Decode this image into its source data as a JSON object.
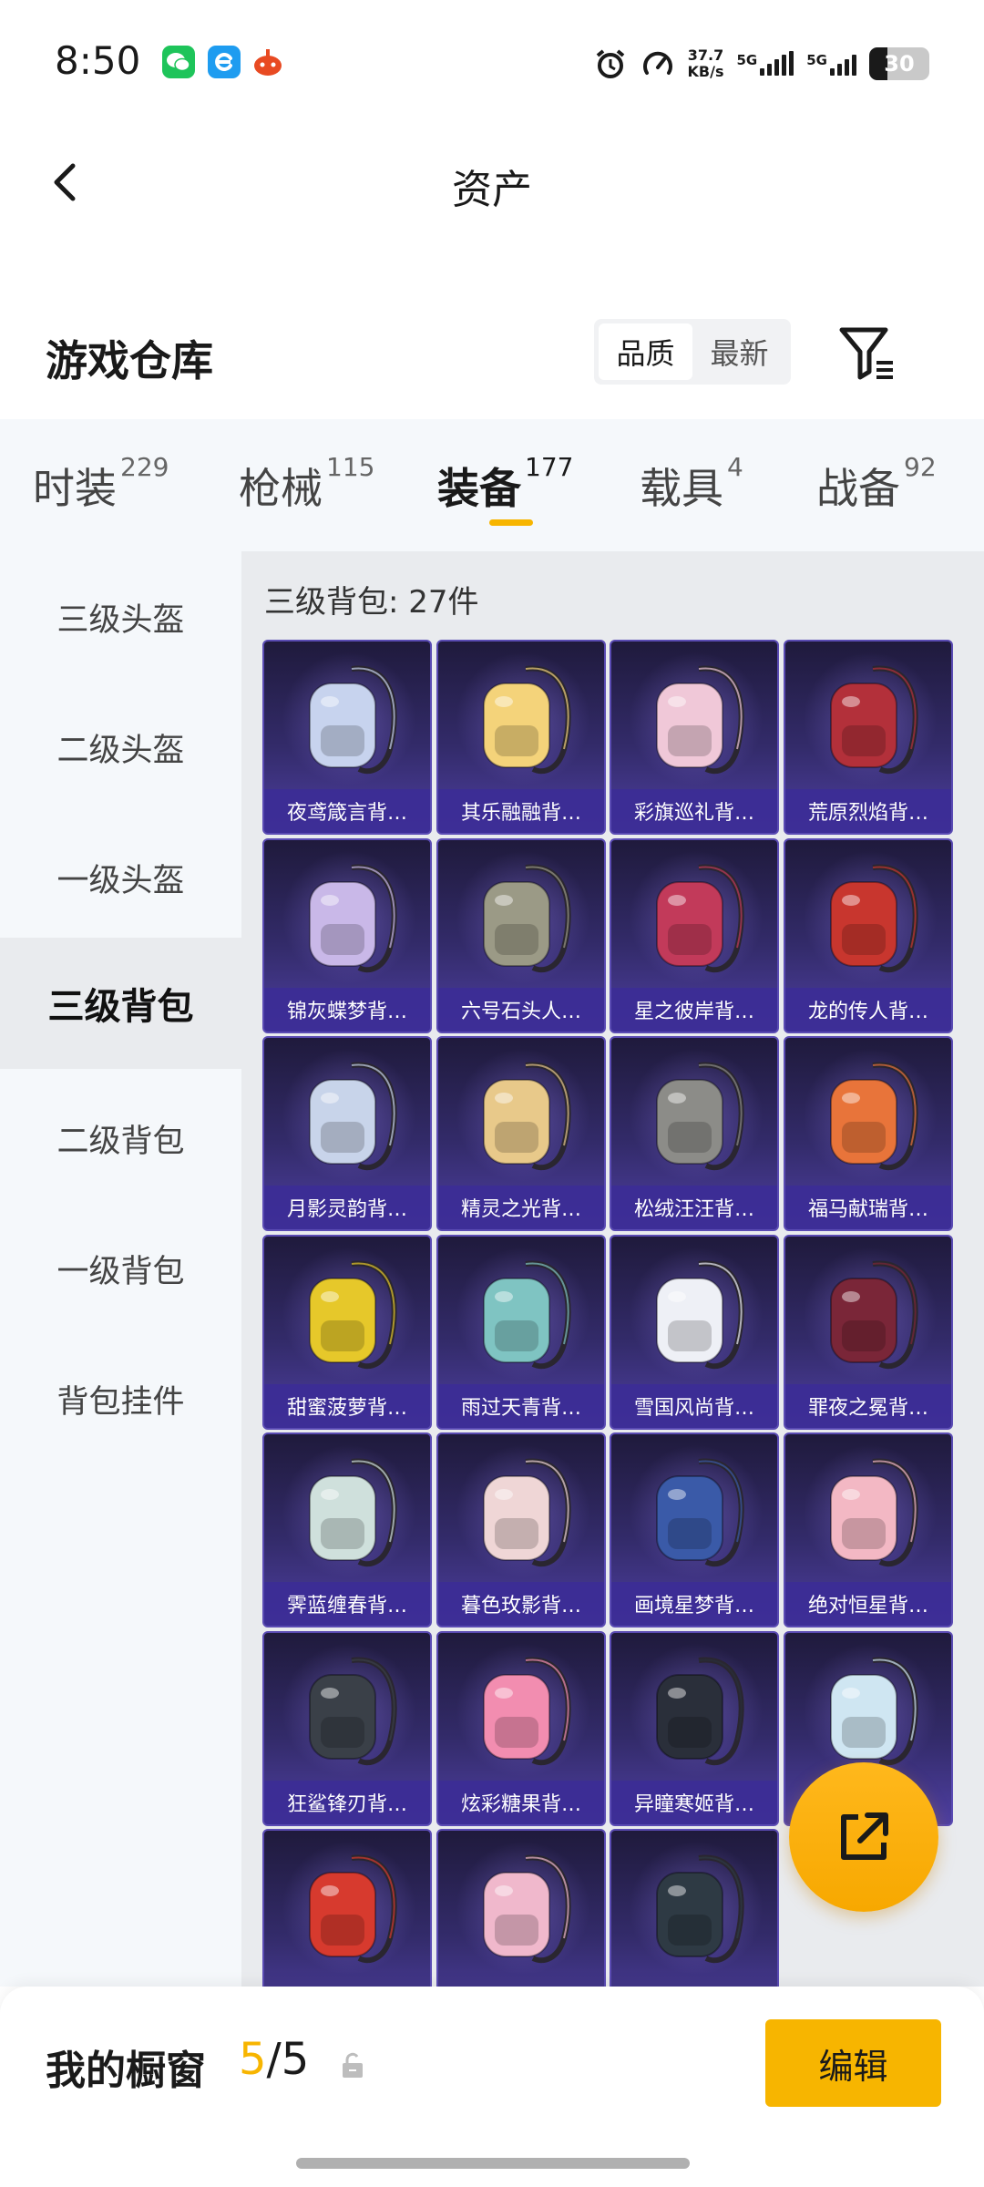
{
  "status_bar": {
    "time": "8:50",
    "net_speed_value": "37.7",
    "net_speed_unit": "KB/s",
    "sim1_label": "5G",
    "sim2_label": "5G",
    "battery": "30",
    "icons": [
      "wechat-icon",
      "browser-icon",
      "game-app-icon",
      "alarm-icon",
      "speedometer-icon"
    ]
  },
  "nav": {
    "title": "资产"
  },
  "warehouse": {
    "title": "游戏仓库",
    "sort_options": [
      "品质",
      "最新"
    ],
    "active_sort": "品质"
  },
  "tabs": [
    {
      "label": "时装",
      "count": "229"
    },
    {
      "label": "枪械",
      "count": "115"
    },
    {
      "label": "装备",
      "count": "177"
    },
    {
      "label": "载具",
      "count": "4"
    },
    {
      "label": "战备",
      "count": "92"
    }
  ],
  "active_tab": "装备",
  "sidebar": {
    "items": [
      "三级头盔",
      "二级头盔",
      "一级头盔",
      "三级背包",
      "二级背包",
      "一级背包",
      "背包挂件"
    ],
    "active": "三级背包"
  },
  "content": {
    "header": "三级背包: 27件",
    "items": [
      {
        "label": "夜鸢箴言背…",
        "color": "#c7d3ee"
      },
      {
        "label": "其乐融融背…",
        "color": "#f4d37a"
      },
      {
        "label": "彩旗巡礼背…",
        "color": "#f0c8d8"
      },
      {
        "label": "荒原烈焰背…",
        "color": "#b3303a"
      },
      {
        "label": "锦灰蝶梦背…",
        "color": "#c9b8e8"
      },
      {
        "label": "六号石头人…",
        "color": "#9b9a86"
      },
      {
        "label": "星之彼岸背…",
        "color": "#c23a5a"
      },
      {
        "label": "龙的传人背…",
        "color": "#c8362e"
      },
      {
        "label": "月影灵韵背…",
        "color": "#c8d4ea"
      },
      {
        "label": "精灵之光背…",
        "color": "#e8c98a"
      },
      {
        "label": "松绒汪汪背…",
        "color": "#8c8c88"
      },
      {
        "label": "福马献瑞背…",
        "color": "#e8743a"
      },
      {
        "label": "甜蜜菠萝背…",
        "color": "#e6c82a"
      },
      {
        "label": "雨过天青背…",
        "color": "#7fc4c2"
      },
      {
        "label": "雪国风尚背…",
        "color": "#eef0f6"
      },
      {
        "label": "罪夜之冕背…",
        "color": "#7a2638"
      },
      {
        "label": "霁蓝缠春背…",
        "color": "#cfe0dc"
      },
      {
        "label": "暮色玫影背…",
        "color": "#efd6d6"
      },
      {
        "label": "画境星梦背…",
        "color": "#3a5aa8"
      },
      {
        "label": "绝对恒星背…",
        "color": "#f3b8c4"
      },
      {
        "label": "狂鲨锋刃背…",
        "color": "#3a4048"
      },
      {
        "label": "炫彩糖果背…",
        "color": "#f28db0"
      },
      {
        "label": "异瞳寒姬背…",
        "color": "#2a2f3a"
      },
      {
        "label": "",
        "color": "#cfe6f2"
      },
      {
        "label": "",
        "color": "#d73a2e"
      },
      {
        "label": "",
        "color": "#f0b8cc"
      },
      {
        "label": "",
        "color": "#2e3a44"
      }
    ]
  },
  "showcase": {
    "label": "我的橱窗",
    "current": "5",
    "separator": "/",
    "total": "5",
    "edit_label": "编辑"
  },
  "colors": {
    "accent": "#f7b500",
    "card_top": "#1f1a3c",
    "card_bottom": "#4e3fa1",
    "sidebar_bg": "#f5f8fb",
    "content_bg": "#e9ebee"
  }
}
